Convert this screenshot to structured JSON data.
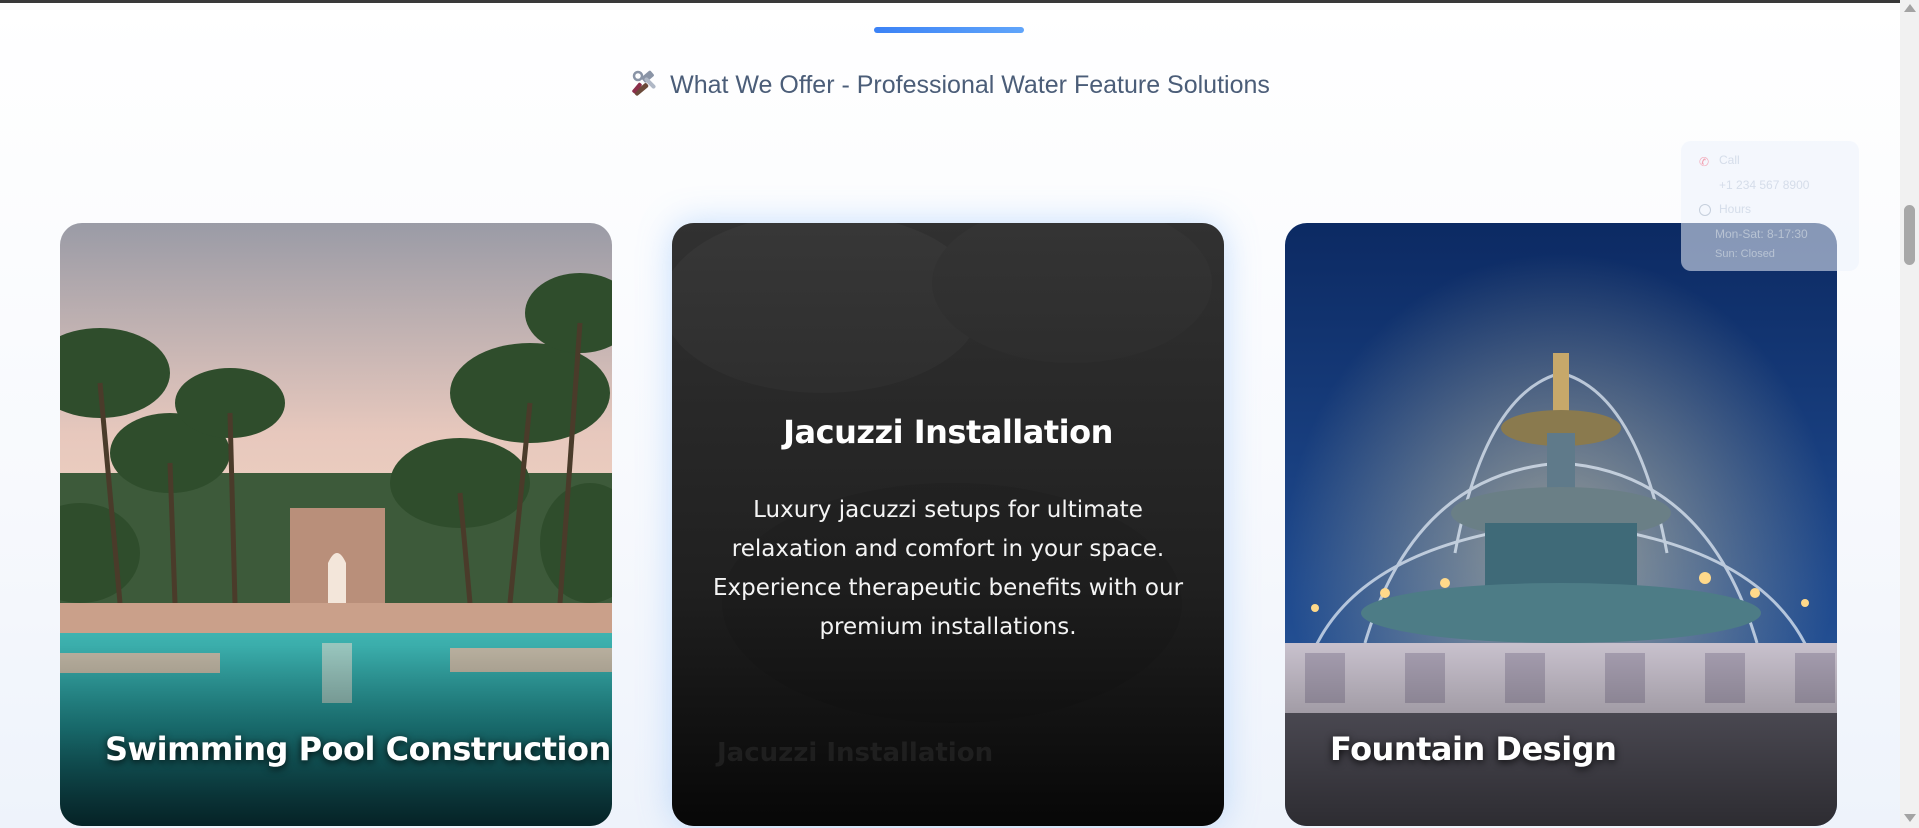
{
  "section": {
    "subtitle": "What We Offer - Professional Water Feature Solutions",
    "subtitle_icon": "tools-icon",
    "accent_color": "#3b82f6"
  },
  "services": [
    {
      "title": "Swimming Pool Construction",
      "image": "palm-pool-photo"
    },
    {
      "title": "Jacuzzi Installation",
      "description": "Luxury jacuzzi setups for ultimate relaxation and comfort in your space. Experience therapeutic benefits with our premium installations.",
      "image": "jacuzzi-photo"
    },
    {
      "title": "Fountain Design",
      "image": "night-fountain-photo"
    }
  ],
  "contact_widget": {
    "call_label": "Call",
    "phone": "+1 234 567 8900",
    "hours_label": "Hours",
    "hours_weekday": "Mon-Sat: 8-17:30",
    "hours_sunday": "Sun: Closed"
  }
}
